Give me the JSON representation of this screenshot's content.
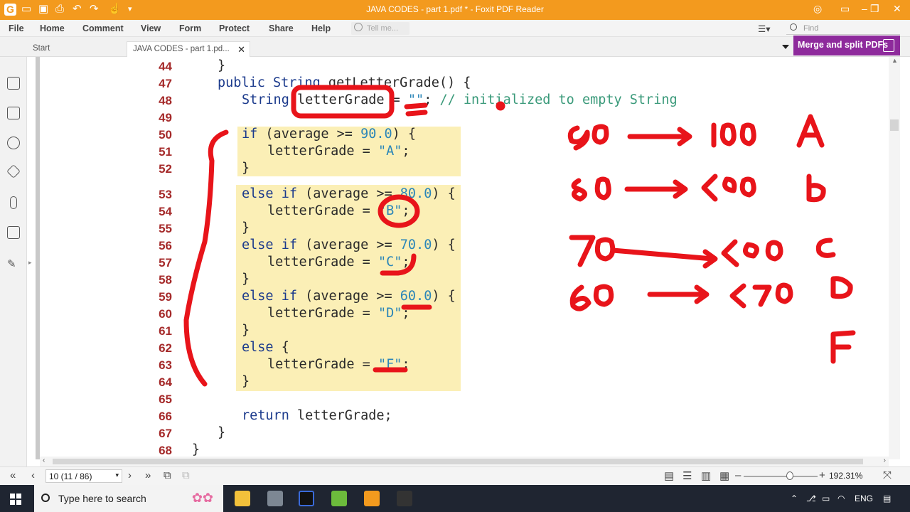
{
  "window": {
    "title": "JAVA CODES - part 1.pdf * - Foxit PDF Reader"
  },
  "menu": [
    "File",
    "Home",
    "Comment",
    "View",
    "Form",
    "Protect",
    "Share",
    "Help"
  ],
  "tell_me_placeholder": "Tell me...",
  "find_placeholder": "Find",
  "tabs": [
    {
      "label": "Start"
    },
    {
      "label": "JAVA CODES - part 1.pd..."
    }
  ],
  "merge_button": "Merge and split PDFs",
  "code": [
    {
      "n": "44",
      "text": "}"
    },
    {
      "n": "47",
      "text": "public String getLetterGrade() {"
    },
    {
      "n": "48",
      "text": "String letterGrade = \"\"; // initialized to empty String"
    },
    {
      "n": "49",
      "text": ""
    },
    {
      "n": "50",
      "text": "if (average >= 90.0) {"
    },
    {
      "n": "51",
      "text": "letterGrade = \"A\";"
    },
    {
      "n": "52",
      "text": "}"
    },
    {
      "n": "53",
      "text": "else if (average >= 80.0) {"
    },
    {
      "n": "54",
      "text": "letterGrade = \"B\";"
    },
    {
      "n": "55",
      "text": "}"
    },
    {
      "n": "56",
      "text": "else if (average >= 70.0) {"
    },
    {
      "n": "57",
      "text": "letterGrade = \"C\";"
    },
    {
      "n": "58",
      "text": "}"
    },
    {
      "n": "59",
      "text": "else if (average >= 60.0) {"
    },
    {
      "n": "60",
      "text": "letterGrade = \"D\";"
    },
    {
      "n": "61",
      "text": "}"
    },
    {
      "n": "62",
      "text": "else {"
    },
    {
      "n": "63",
      "text": "letterGrade = \"F\";"
    },
    {
      "n": "64",
      "text": "}"
    },
    {
      "n": "65",
      "text": ""
    },
    {
      "n": "66",
      "text": "return letterGrade;"
    },
    {
      "n": "67",
      "text": "}"
    },
    {
      "n": "68",
      "text": "}"
    }
  ],
  "handwriting": {
    "rows": [
      {
        "from": "90",
        "to": "100",
        "grade": "A"
      },
      {
        "from": "80",
        "to": "<90",
        "grade": "B"
      },
      {
        "from": "70",
        "to": "<80",
        "grade": "C"
      },
      {
        "from": "60",
        "to": "<70",
        "grade": "D"
      }
    ],
    "else_grade": "F",
    "color": "#e8141a"
  },
  "status": {
    "page": "10 (11 / 86)",
    "zoom": "192.31%"
  },
  "taskbar": {
    "search_placeholder": "Type here to search",
    "lang": "ENG"
  },
  "colors": {
    "titlebar": "#f39a1e",
    "merge_bg": "#8e2a9c",
    "highlight": "#fbefb6",
    "line_number": "#a52a2a"
  }
}
